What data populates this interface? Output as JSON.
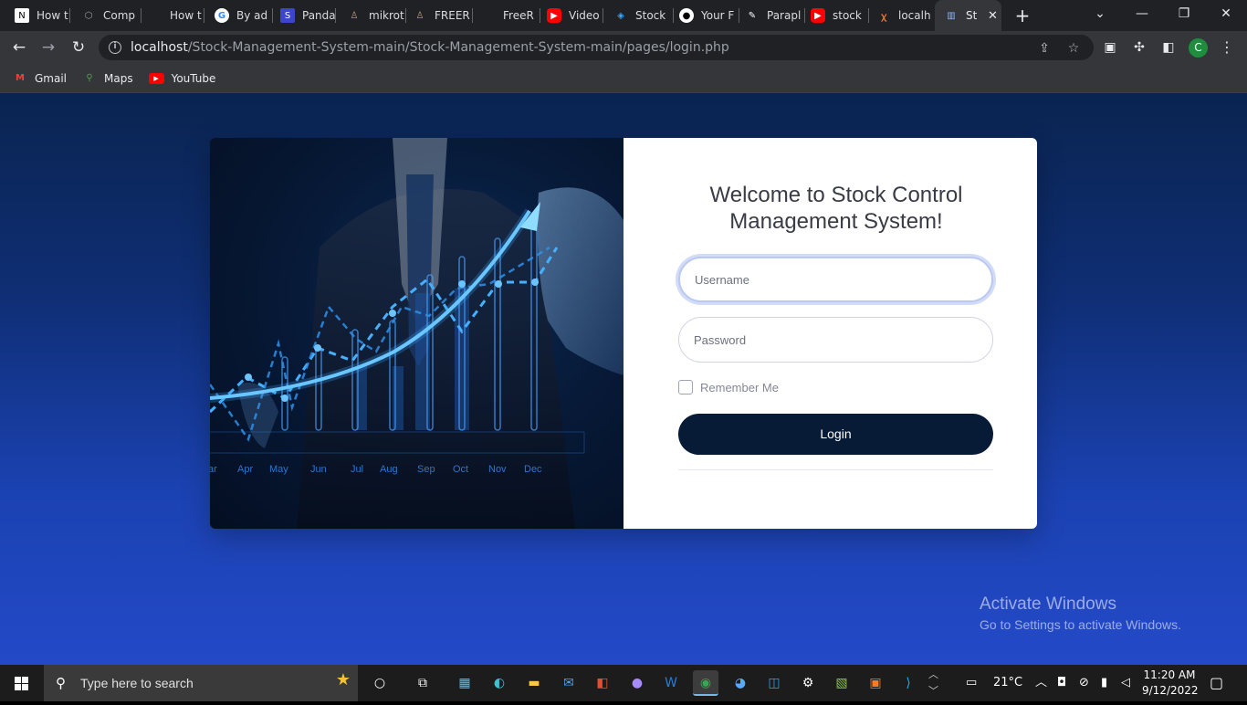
{
  "tabs": [
    {
      "title": "How t",
      "icon": "notion",
      "active": false
    },
    {
      "title": "Comp",
      "icon": "hexagon",
      "active": false
    },
    {
      "title": "How t",
      "icon": "none",
      "active": false
    },
    {
      "title": "By ad",
      "icon": "google",
      "active": false
    },
    {
      "title": "Panda",
      "icon": "shield",
      "active": false
    },
    {
      "title": "mikrot",
      "icon": "avatar",
      "active": false
    },
    {
      "title": "FREER",
      "icon": "avatar",
      "active": false
    },
    {
      "title": "FreeR",
      "icon": "none",
      "active": false
    },
    {
      "title": "Video",
      "icon": "youtube",
      "active": false
    },
    {
      "title": "Stock",
      "icon": "drop",
      "active": false
    },
    {
      "title": "Your F",
      "icon": "github",
      "active": false
    },
    {
      "title": "Parapl",
      "icon": "pen",
      "active": false
    },
    {
      "title": "stock",
      "icon": "youtube",
      "active": false
    },
    {
      "title": "localh",
      "icon": "xampp",
      "active": false
    },
    {
      "title": "St",
      "icon": "chart",
      "active": true
    }
  ],
  "new_tab_label": "+",
  "window_controls": {
    "dropdown": "⌄",
    "minimize": "—",
    "restore": "❐",
    "close": "✕"
  },
  "address": {
    "host": "localhost",
    "path": "/Stock-Management-System-main/Stock-Management-System-main/pages/login.php"
  },
  "bookmarks": [
    {
      "label": "Gmail",
      "icon": "gmail-icon"
    },
    {
      "label": "Maps",
      "icon": "maps-icon"
    },
    {
      "label": "YouTube",
      "icon": "youtube-icon"
    }
  ],
  "profile_initial": "C",
  "hero_chart": {
    "months": [
      "ar",
      "Apr",
      "May",
      "Jun",
      "Jul",
      "Aug",
      "Sep",
      "Oct",
      "Nov",
      "Dec"
    ]
  },
  "login": {
    "welcome": "Welcome to Stock Control Management System!",
    "username_placeholder": "Username",
    "password_placeholder": "Password",
    "remember": "Remember Me",
    "button": "Login"
  },
  "watermark": {
    "line1": "Activate Windows",
    "line2": "Go to Settings to activate Windows."
  },
  "taskbar": {
    "search_placeholder": "Type here to search",
    "weather": "21°C",
    "time": "11:20 AM",
    "date": "9/12/2022"
  },
  "colors": {
    "page_bg_top": "#0a2450",
    "page_bg_bottom": "#2449c8",
    "login_button": "#071a36",
    "chart_glow": "#3aa7ff"
  }
}
